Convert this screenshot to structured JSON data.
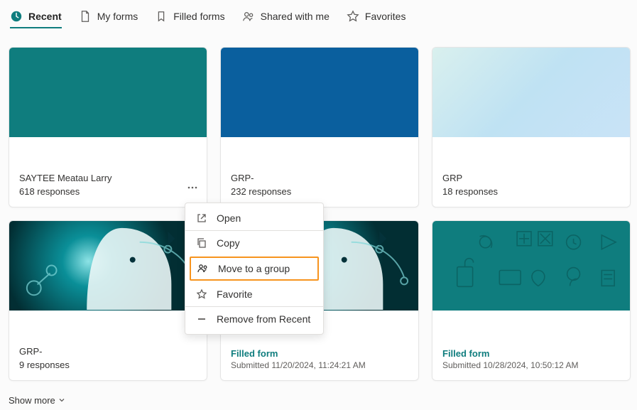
{
  "tabs": {
    "recent": "Recent",
    "myforms": "My forms",
    "filled": "Filled forms",
    "shared": "Shared with me",
    "favorites": "Favorites"
  },
  "cards": [
    {
      "title": "SAYTEE Meatau Larry",
      "sub": "618 responses"
    },
    {
      "title": "GRP-",
      "sub": "232 responses"
    },
    {
      "title": "GRP",
      "sub": "18 responses"
    },
    {
      "title": "GRP-",
      "sub": "9 responses"
    },
    {
      "filled": "Filled form",
      "submitted": "Submitted 11/20/2024, 11:24:21 AM"
    },
    {
      "filled": "Filled form",
      "submitted": "Submitted 10/28/2024, 10:50:12 AM"
    }
  ],
  "menu": {
    "open": "Open",
    "copy": "Copy",
    "move": "Move to a group",
    "favorite": "Favorite",
    "remove": "Remove from Recent"
  },
  "showmore": "Show more"
}
